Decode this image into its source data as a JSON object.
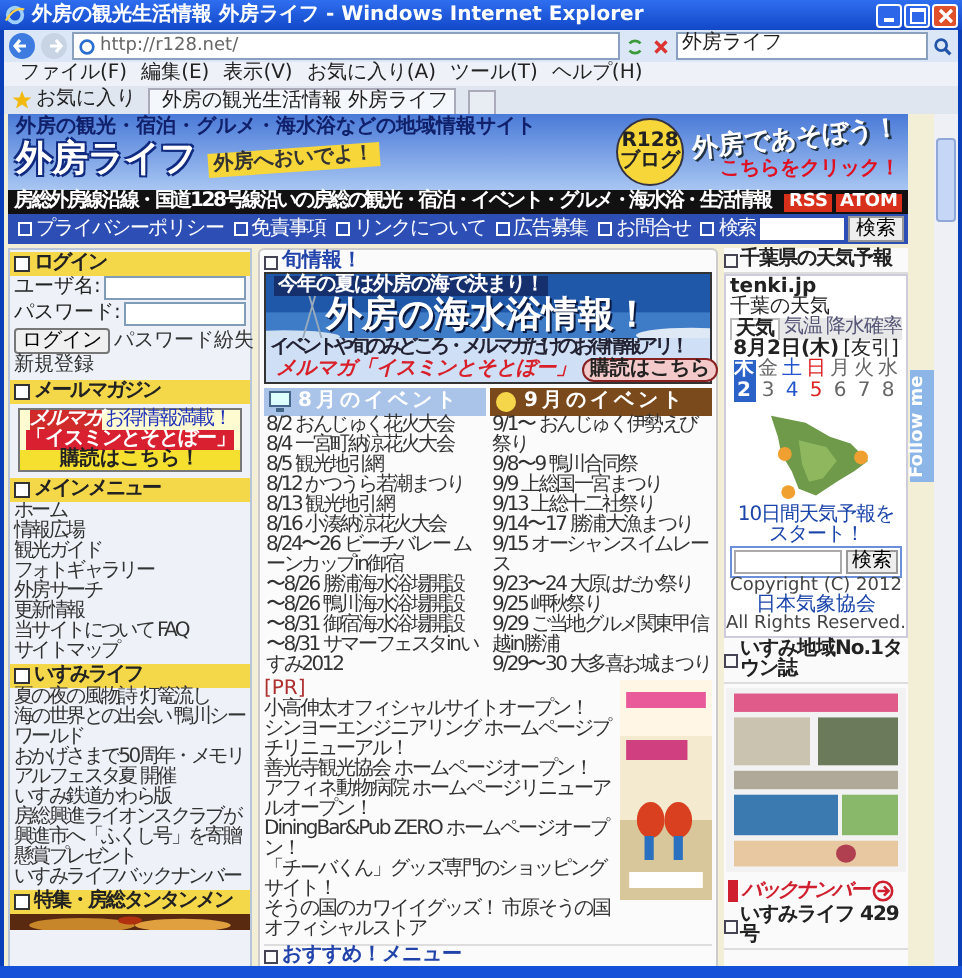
{
  "window": {
    "title": "外房の観光生活情報 外房ライフ - Windows Internet Explorer"
  },
  "address_bar": {
    "url": "http://r128.net/",
    "search": "外房ライフ"
  },
  "menu": [
    "ファイル(F)",
    "編集(E)",
    "表示(V)",
    "お気に入り(A)",
    "ツール(T)",
    "ヘルプ(H)"
  ],
  "favorites": {
    "label": "お気に入り",
    "tab": "外房の観光生活情報 外房ライフ"
  },
  "header": {
    "tagline": "外房の観光・宿泊・グルメ・海水浴などの地域情報サイト",
    "logo": "外房ライフ",
    "slogan": "外房へおいでよ！",
    "badge": "R128 ブログ",
    "promo": "外房であそぼう！",
    "promo_link": "こちらをクリック！"
  },
  "strip": {
    "text": "房総外房線沿線・国道128号線沿いの房総の観光・宿泊・イベント・グルメ・海水浴・生活情報",
    "feeds": [
      "RSS",
      "ATOM"
    ]
  },
  "nav": {
    "links": [
      "プライバシーポリシー",
      "免責事項",
      "リンクについて",
      "広告募集",
      "お問合せ"
    ],
    "search_label": "検索",
    "search_button": "検索"
  },
  "sidebar": {
    "login": {
      "title": "ログイン",
      "user_label": "ユーザ名:",
      "pass_label": "パスワード:",
      "button": "ログイン",
      "links": [
        "パスワード紛失",
        "新規登録"
      ]
    },
    "mail": {
      "title": "メールマガジン",
      "tag": "メルマガ",
      "note": "お得情報満載！",
      "name": "「イスミンとそとぼー」",
      "cta": "購読はこちら！"
    },
    "main_menu": {
      "title": "メインメニュー",
      "items": [
        "ホーム",
        "情報広場",
        "観光ガイド",
        "フォトギャラリー",
        "外房サーチ",
        "更新情報",
        "当サイトについて FAQ",
        "サイトマップ"
      ]
    },
    "izumi": {
      "title": "いすみライフ",
      "items": [
        "夏の夜の風物詩 灯篭流し",
        "海の世界との出会い 鴨川シーワールド",
        "おかげさまで50周年・メモリアルフェスタ夏 開催",
        "いすみ鉄道かわら版",
        "房総興進ライオンスクラブが興進市へ「ふくし号」を寄贈",
        "懸賞プレゼント",
        "いすみライフバックナンバー"
      ]
    },
    "special": {
      "title": "特集・房総タンタンメン"
    }
  },
  "main": {
    "news_title": "旬情報！",
    "banner": {
      "kicker": "今年の夏は外房の海で決まり！",
      "headline": "外房の海水浴情報！",
      "sub": "イベントや旬のみどころ・メルマガだけのお得情報アリ！",
      "mail": "メルマガ「イスミンとそとぼー」",
      "cta": "購読はこちら"
    },
    "events": [
      {
        "title": "8月のイベント",
        "color": "#a9c4e8",
        "items": [
          "8/2 おんじゅく花火大会",
          "8/4 一宮町納涼花火大会",
          "8/5 観光地引網",
          "8/12 かつうら若潮まつり",
          "8/13 観光地引網",
          "8/16 小湊納涼花火大会",
          "8/24〜26 ビーチバレー ムーンカップin御宿",
          "〜8/26 勝浦海水浴場開設",
          "〜8/26 鴨川海水浴場開設",
          "〜8/31 御宿海水浴場開設",
          "〜8/31 サマーフェスタinいすみ2012"
        ]
      },
      {
        "title": "9月のイベント",
        "color": "#7a4a1c",
        "items": [
          "9/1〜 おんじゅく伊勢えび祭り",
          "9/8〜9 鴨川合同祭",
          "9/9 上総国一宮まつり",
          "9/13 上総十二社祭り",
          "9/14〜17 勝浦大漁まつり",
          "9/15 オーシャンスイムレース",
          "9/23〜24 大原はだか祭り",
          "9/25 岬秋祭り",
          "9/29 ご当地グルメ関東甲信越in勝浦",
          "9/29〜30 大多喜お城まつり"
        ]
      }
    ],
    "pr": {
      "label": "[PR]",
      "items": [
        "小高伸太オフィシャルサイトオープン！",
        "シンヨーエンジニアリング ホームページプチリニューアル！",
        "善光寺観光協会 ホームページオープン！",
        "アフィネ動物病院 ホームページリニューアルオープン！",
        "DiningBar&Pub ZERO ホームページオープン！",
        "「チーバくん」グッズ専門のショッピングサイト！",
        "そうの国のカワイイグッズ！ 市原そうの国オフィシャルストア"
      ]
    },
    "recommend_title": "おすすめ！メニュー"
  },
  "right": {
    "weather": {
      "title": "千葉県の天気予報",
      "brand": "tenki.jp",
      "region": "千葉の天気",
      "tabs": [
        {
          "label": "天気",
          "selected": true
        },
        {
          "label": "気温",
          "selected": false
        },
        {
          "label": "降水確率",
          "selected": false
        }
      ],
      "date": "8月2日(木)",
      "rokuyo": "[友引]",
      "days": [
        {
          "weekday": "木",
          "day": "2",
          "color": "#2a62c8",
          "selected": true
        },
        {
          "weekday": "金",
          "day": "3",
          "color": "#666666",
          "selected": false
        },
        {
          "weekday": "土",
          "day": "4",
          "color": "#2255cc",
          "selected": false
        },
        {
          "weekday": "日",
          "day": "5",
          "color": "#dd2222",
          "selected": false
        },
        {
          "weekday": "月",
          "day": "6",
          "color": "#666666",
          "selected": false
        },
        {
          "weekday": "火",
          "day": "7",
          "color": "#666666",
          "selected": false
        },
        {
          "weekday": "水",
          "day": "8",
          "color": "#666666",
          "selected": false
        }
      ],
      "forecast_link": "10日間天気予報をスタート！",
      "search_button": "検索",
      "copyright": "Copyright (C) 2012",
      "org": "日本気象協会",
      "rights": "All Rights Reserved."
    },
    "town_title": "いすみ地域No.1タウン誌",
    "backnumber": "バックナンバー",
    "issue_title": "いすみライフ 429号"
  },
  "follow": "Follow me"
}
